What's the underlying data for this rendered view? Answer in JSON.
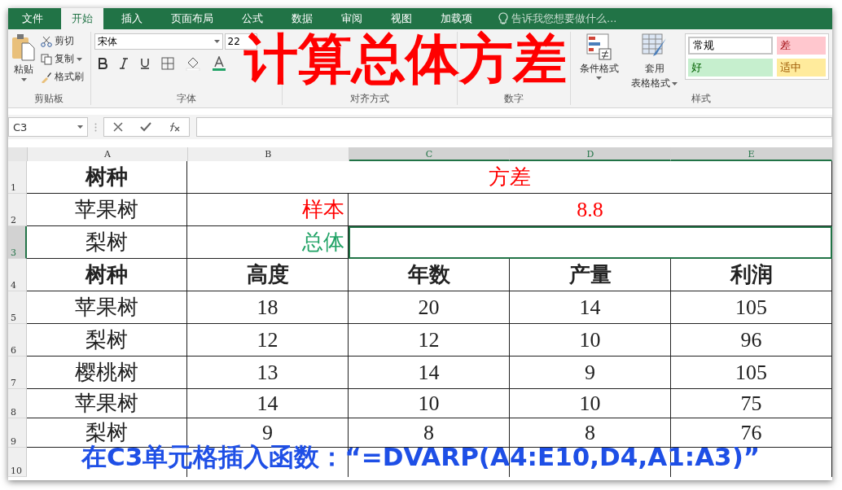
{
  "tabs": [
    {
      "label": "文件",
      "selected": false
    },
    {
      "label": "开始",
      "selected": true
    },
    {
      "label": "插入",
      "selected": false
    },
    {
      "label": "页面布局",
      "selected": false
    },
    {
      "label": "公式",
      "selected": false
    },
    {
      "label": "数据",
      "selected": false
    },
    {
      "label": "审阅",
      "selected": false
    },
    {
      "label": "视图",
      "selected": false
    },
    {
      "label": "加载项",
      "selected": false
    }
  ],
  "tell_me": "告诉我您想要做什么...",
  "clipboard": {
    "paste": "粘贴",
    "cut": "剪切",
    "copy": "复制",
    "format_painter": "格式刷",
    "group": "剪贴板"
  },
  "font": {
    "name": "宋体",
    "size": "22",
    "group": "字体"
  },
  "alignment": {
    "group": "对齐方式"
  },
  "number": {
    "group": "数字"
  },
  "styles": {
    "conditional": "条件格式",
    "table_format_1": "套用",
    "table_format_2": "表格格式",
    "group": "样式",
    "cells": [
      {
        "label": "常规",
        "kind": "normal"
      },
      {
        "label": "差",
        "kind": "bad"
      },
      {
        "label": "好",
        "kind": "good"
      },
      {
        "label": "适中",
        "kind": "neutral"
      }
    ]
  },
  "name_box": "C3",
  "columns": [
    {
      "label": "A",
      "selected": false
    },
    {
      "label": "B",
      "selected": false
    },
    {
      "label": "C",
      "selected": true
    },
    {
      "label": "D",
      "selected": true
    },
    {
      "label": "E",
      "selected": true
    }
  ],
  "rows": [
    {
      "number": "1",
      "selected": false,
      "cells": [
        {
          "text": "树种",
          "bold": true
        },
        {
          "text": "方差",
          "bold": false,
          "color": "#ff0000"
        }
      ]
    },
    {
      "number": "2",
      "selected": false,
      "cells": [
        {
          "text": "苹果树",
          "bold": false
        },
        {
          "text": "样本",
          "kind": "label",
          "bold": false,
          "color": "#ff0000"
        },
        {
          "text": "8.8",
          "bold": false,
          "color": "#ff0000"
        }
      ]
    },
    {
      "number": "3",
      "selected": true,
      "cells": [
        {
          "text": "梨树",
          "bold": false
        },
        {
          "text": "总体",
          "kind": "label",
          "bold": false,
          "color": "#21a366"
        },
        {
          "selected": true
        }
      ]
    },
    {
      "number": "4",
      "selected": false,
      "cells": [
        {
          "text": "树种",
          "bold": true
        },
        {
          "text": "高度",
          "bold": true
        },
        {
          "text": "年数",
          "bold": true
        },
        {
          "text": "产量",
          "bold": true
        },
        {
          "text": "利润",
          "bold": true
        }
      ]
    },
    {
      "number": "5",
      "selected": false,
      "cells": [
        {
          "text": "苹果树",
          "bold": false
        },
        {
          "text": "18",
          "bold": false
        },
        {
          "text": "20",
          "bold": false
        },
        {
          "text": "14",
          "bold": false
        },
        {
          "text": "105",
          "bold": false
        }
      ]
    },
    {
      "number": "6",
      "selected": false,
      "cells": [
        {
          "text": "梨树",
          "bold": false
        },
        {
          "text": "12",
          "bold": false
        },
        {
          "text": "12",
          "bold": false
        },
        {
          "text": "10",
          "bold": false
        },
        {
          "text": "96",
          "bold": false
        }
      ]
    },
    {
      "number": "7",
      "selected": false,
      "cells": [
        {
          "text": "樱桃树",
          "bold": false
        },
        {
          "text": "13",
          "bold": false
        },
        {
          "text": "14",
          "bold": false
        },
        {
          "text": "9",
          "bold": false
        },
        {
          "text": "105",
          "bold": false
        }
      ]
    },
    {
      "number": "8",
      "selected": false,
      "cells": [
        {
          "text": "苹果树",
          "bold": false
        },
        {
          "text": "14",
          "bold": false
        },
        {
          "text": "10",
          "bold": false
        },
        {
          "text": "10",
          "bold": false
        },
        {
          "text": "75",
          "bold": false
        }
      ]
    },
    {
      "number": "9",
      "selected": false,
      "cells": [
        {
          "text": "梨树",
          "bold": false
        },
        {
          "text": "9",
          "bold": false
        },
        {
          "text": "8",
          "bold": false
        },
        {
          "text": "8",
          "bold": false
        },
        {
          "text": "76",
          "bold": false
        }
      ]
    },
    {
      "number": "10",
      "selected": false,
      "cells": []
    }
  ],
  "overlay": {
    "title": "计算总体方差",
    "caption": "在C3单元格插入函数：“=DVARP(A4:E10,D4,A1:A3)”"
  }
}
